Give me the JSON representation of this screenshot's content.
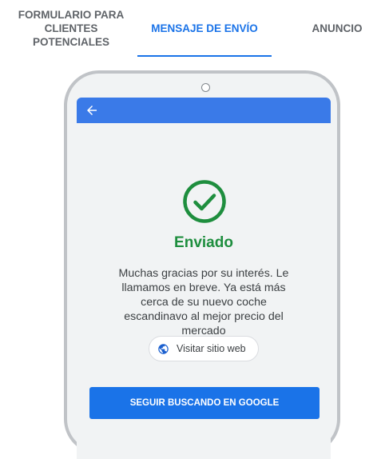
{
  "tabs": {
    "lead_form": "FORMULARIO PARA\nCLIENTES\nPOTENCIALES",
    "submit_message": "MENSAJE DE ENVÍO",
    "ad": "ANUNCIO"
  },
  "screen": {
    "status_title": "Enviado",
    "message": "Muchas gracias por su interés. Le llamamos en breve. Ya está más cerca de su nuevo coche escandinavo al mejor precio del mercado",
    "visit_website_label": "Visitar sitio web",
    "continue_button_label": "SEGUIR BUSCANDO EN GOOGLE"
  },
  "colors": {
    "accent": "#1a73e8",
    "success": "#1e8e3e",
    "header_bar": "#3a7ae8"
  },
  "icons": {
    "back": "arrow-left-icon",
    "status": "check-circle-icon",
    "website": "globe-icon"
  }
}
